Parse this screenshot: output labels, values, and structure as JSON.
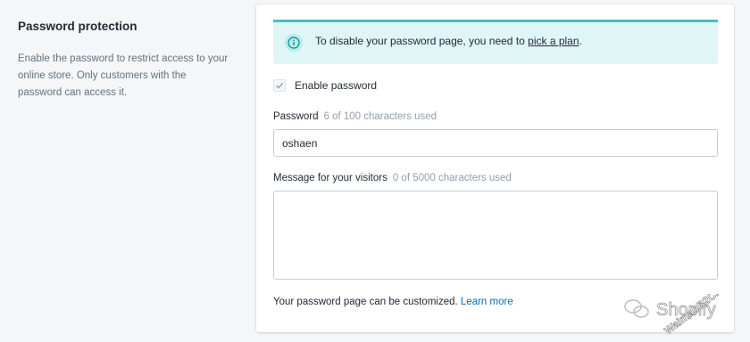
{
  "section": {
    "title": "Password protection",
    "description": "Enable the password to restrict access to your online store. Only customers with the password can access it."
  },
  "banner": {
    "text_before": "To disable your password page, you need to ",
    "link": "pick a plan",
    "text_after": ".",
    "icon": "info-icon",
    "color": "#47c1bf"
  },
  "enable_password": {
    "label": "Enable password",
    "checked": true
  },
  "password_field": {
    "label": "Password",
    "hint": "6 of 100 characters used",
    "value": "oshaen"
  },
  "message_field": {
    "label": "Message for your visitors",
    "hint": "0 of 5000 characters used",
    "value": ""
  },
  "footer": {
    "text": "Your password page can be customized.",
    "link": "Learn more"
  },
  "watermark": {
    "brand": "Shopify",
    "domain": "WaimaoB2C.com"
  }
}
